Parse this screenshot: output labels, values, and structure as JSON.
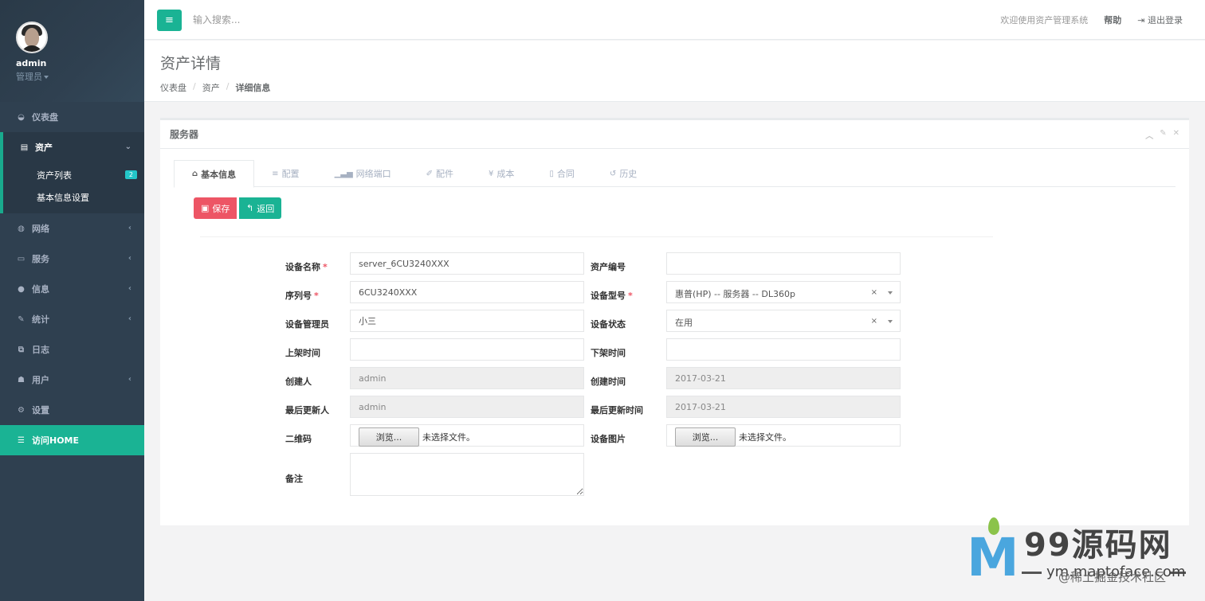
{
  "sidebar": {
    "user_name": "admin",
    "user_role": "管理员",
    "items": [
      {
        "icon": "dashboard-icon",
        "glyph": "◒",
        "label": "仪表盘"
      },
      {
        "icon": "asset-icon",
        "glyph": "▤",
        "label": "资产",
        "open": true
      },
      {
        "icon": "globe-icon",
        "glyph": "◍",
        "label": "网络"
      },
      {
        "icon": "drive-icon",
        "glyph": "▭",
        "label": "服务"
      },
      {
        "icon": "info-icon",
        "glyph": "●",
        "label": "信息"
      },
      {
        "icon": "edit-icon",
        "glyph": "✎",
        "label": "统计"
      },
      {
        "icon": "copy-icon",
        "glyph": "⧉",
        "label": "日志"
      },
      {
        "icon": "users-icon",
        "glyph": "☗",
        "label": "用户"
      },
      {
        "icon": "gears-icon",
        "glyph": "⚙",
        "label": "设置"
      },
      {
        "icon": "database-icon",
        "glyph": "☰",
        "label": "访问HOME"
      }
    ],
    "subitems": [
      {
        "label": "资产列表",
        "badge": "2"
      },
      {
        "label": "基本信息设置"
      }
    ]
  },
  "topbar": {
    "menu_icon": "bars-icon",
    "search_placeholder": "输入搜索...",
    "welcome": "欢迎使用资产管理系统",
    "help": "帮助",
    "logout": "退出登录"
  },
  "heading": {
    "title": "资产详情",
    "breadcrumb": [
      "仪表盘",
      "资产",
      "详细信息"
    ]
  },
  "box": {
    "title": "服务器",
    "tabs": [
      {
        "glyph": "⌂",
        "label": "基本信息"
      },
      {
        "glyph": "≡",
        "label": "配置"
      },
      {
        "glyph": "▁▃▅",
        "label": "网络端口"
      },
      {
        "glyph": "✐",
        "label": "配件"
      },
      {
        "glyph": "¥",
        "label": "成本"
      },
      {
        "glyph": "▯",
        "label": "合同"
      },
      {
        "glyph": "↺",
        "label": "历史"
      }
    ],
    "save_label": "保存",
    "back_label": "返回"
  },
  "form": {
    "device_name_label": "设备名称",
    "device_name": "server_6CU3240XXX",
    "asset_no_label": "资产编号",
    "asset_no": "",
    "serial_label": "序列号",
    "serial": "6CU3240XXX",
    "model_label": "设备型号",
    "model": "惠普(HP) -- 服务器 -- DL360p",
    "manager_label": "设备管理员",
    "manager": "小三",
    "status_label": "设备状态",
    "status": "在用",
    "online_label": "上架时间",
    "online": "",
    "offline_label": "下架时间",
    "offline": "",
    "creator_label": "创建人",
    "creator": "admin",
    "created_label": "创建时间",
    "created": "2017-03-21",
    "updater_label": "最后更新人",
    "updater": "admin",
    "updated_label": "最后更新时间",
    "updated": "2017-03-21",
    "qrcode_label": "二维码",
    "image_label": "设备图片",
    "browse": "浏览...",
    "no_file": "未选择文件。",
    "notes_label": "备注",
    "notes": "",
    "clear": "×"
  },
  "watermark": {
    "brand": "99源码网",
    "url": "ym.maptoface.com",
    "community": "@稀土掘金技术社区"
  }
}
